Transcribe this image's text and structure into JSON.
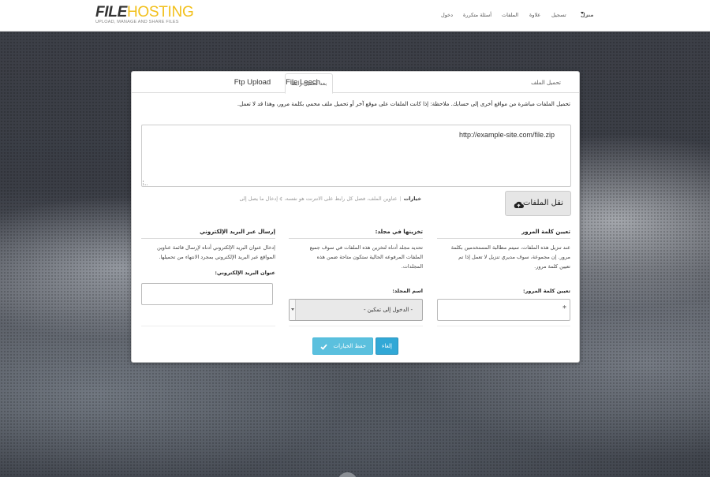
{
  "header": {
    "logo_part1": "FILE",
    "logo_part2": "HOSTING",
    "tagline": "UPLOAD, MANAGE AND SHARE FILES",
    "nav": {
      "home": "منزل",
      "register": "تسجيل",
      "pricing": "علاوة",
      "files": "الملفات",
      "faq": "أسئلة متكررة",
      "login": "دخول"
    }
  },
  "panel": {
    "tabs": {
      "upload_file": "تحميل الملف",
      "remote_url": "بعد تحميل رابط",
      "ftp_upload": "Ftp Upload",
      "file_leech": "File Leech"
    },
    "intro": "تحميل الملفات مباشرة من مواقع أخرى إلى حسابك. ملاحظة: إذا كانت الملفات على موقع آخر أو تحميل ملف محمي بكلمة مرور، وهذا قد لا تعمل.",
    "url_value": "http://example-site.com/file.zip",
    "transfer_button": "نقل الملفات",
    "options_label": "خيارات",
    "options_hint": "عناوين الملف، فصل كل رابط على الانترنت هو نفسه، ¢ إدخال ما يصل إلى",
    "password": {
      "title": "تعيين كلمة المرور",
      "desc_lines": [
        "عند تنزيل هذه الملفات، سيتم مطالبة المستخدمين بكلمة",
        "مرور. إن مجموعة، سوف مديري تنزيل لا تعمل إذا تم",
        "تعيين كلمة مرور."
      ],
      "field_label": "تعيين كلمة المرور:",
      "field_value": "*"
    },
    "folder": {
      "title": "تخزينها في مجلد:",
      "desc_lines": [
        "تحديد مجلد أدناه لتخزين هذه الملفات في سوف جميع",
        "الملفات المرفوعه الحالية ستكون متاحة ضمن هذه",
        "المجلدات."
      ],
      "field_label": "اسم المجلد:",
      "select_value": "- الدخول إلى تمكين -"
    },
    "email": {
      "title": "إرسال عبر البريد الإلكتروني",
      "desc_lines": [
        "إدخال عنوان البريد الإلكتروني أدناه لإرسال قائمة عناوين",
        "المواقع عبر البريد الإلكتروني بمجرد الانتهاء من تحميلها."
      ],
      "field_label": "عنوان البريد الإلكتروني:",
      "field_value": ""
    },
    "save_button": "حفظ الخيارات",
    "cancel_button": "إلغاء"
  }
}
